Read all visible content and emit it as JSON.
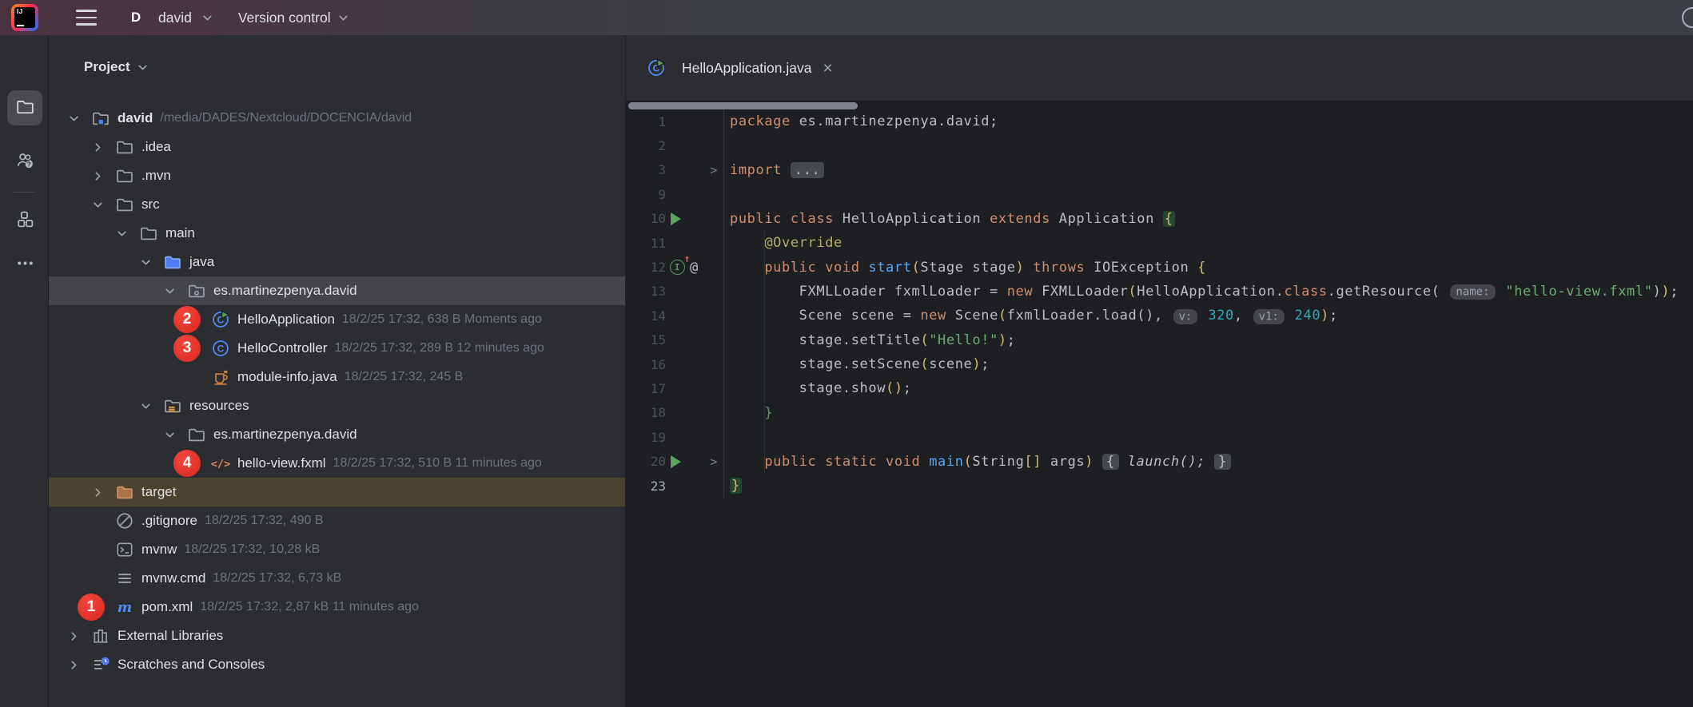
{
  "colors": {
    "topbar_tint": "#4C3340",
    "panel_bg": "#2B2D30",
    "editor_bg": "#1E1F22",
    "selected_row": "#43454A",
    "excluded_row": "#4A432F",
    "badge_red": "#E0382D",
    "keyword": "#CF8E6D",
    "string": "#6AAB73",
    "number": "#2AACB8",
    "method": "#56A8F5",
    "annotation": "#B3AE60",
    "accent_blue": "#4D7DF0"
  },
  "topbar": {
    "avatar_letter": "D",
    "project_name": "david",
    "vcs_label": "Version control"
  },
  "activity_bar": {
    "items": [
      {
        "name": "project",
        "icon": "folder",
        "selected": true
      },
      {
        "name": "learn",
        "icon": "people-help",
        "selected": false
      },
      {
        "name": "structure",
        "icon": "structure",
        "selected": false
      },
      {
        "name": "more",
        "icon": "more",
        "selected": false
      }
    ]
  },
  "project_panel": {
    "title": "Project",
    "rows": [
      {
        "indent": 0,
        "chevron": "down",
        "icon": "folder-root",
        "label": "david",
        "bold": true,
        "meta": "/media/DADES/Nextcloud/DOCENCIA/david"
      },
      {
        "indent": 1,
        "chevron": "right",
        "icon": "folder",
        "label": ".idea"
      },
      {
        "indent": 1,
        "chevron": "right",
        "icon": "folder",
        "label": ".mvn"
      },
      {
        "indent": 1,
        "chevron": "down",
        "icon": "folder",
        "label": "src"
      },
      {
        "indent": 2,
        "chevron": "down",
        "icon": "folder",
        "label": "main"
      },
      {
        "indent": 3,
        "chevron": "down",
        "icon": "folder-java",
        "label": "java"
      },
      {
        "indent": 4,
        "chevron": "down",
        "icon": "package",
        "label": "es.martinezpenya.david",
        "state": "selected"
      },
      {
        "indent": 5,
        "chevron": null,
        "icon": "class-run",
        "label": "HelloApplication",
        "meta": "18/2/25 17:32, 638 B Moments ago",
        "badge": "2"
      },
      {
        "indent": 5,
        "chevron": null,
        "icon": "class",
        "label": "HelloController",
        "meta": "18/2/25 17:32, 289 B 12 minutes ago",
        "badge": "3"
      },
      {
        "indent": 5,
        "chevron": null,
        "icon": "java-cup",
        "label": "module-info.java",
        "meta": "18/2/25 17:32, 245 B"
      },
      {
        "indent": 3,
        "chevron": "down",
        "icon": "folder-res",
        "label": "resources"
      },
      {
        "indent": 4,
        "chevron": "down",
        "icon": "folder",
        "label": "es.martinezpenya.david"
      },
      {
        "indent": 5,
        "chevron": null,
        "icon": "fxml",
        "label": "hello-view.fxml",
        "meta": "18/2/25 17:32, 510 B 11 minutes ago",
        "badge": "4"
      },
      {
        "indent": 1,
        "chevron": "right",
        "icon": "folder-exc",
        "label": "target",
        "state": "excluded"
      },
      {
        "indent": 1,
        "chevron": null,
        "icon": "ignored",
        "label": ".gitignore",
        "meta": "18/2/25 17:32, 490 B"
      },
      {
        "indent": 1,
        "chevron": null,
        "icon": "terminal",
        "label": "mvnw",
        "meta": "18/2/25 17:32, 10,28 kB"
      },
      {
        "indent": 1,
        "chevron": null,
        "icon": "text-lines",
        "label": "mvnw.cmd",
        "meta": "18/2/25 17:32, 6,73 kB"
      },
      {
        "indent": 1,
        "chevron": null,
        "icon": "maven",
        "label": "pom.xml",
        "meta": "18/2/25 17:32, 2,87 kB 11 minutes ago",
        "badge": "1"
      },
      {
        "indent": 0,
        "chevron": "right",
        "icon": "ext-lib",
        "label": "External Libraries"
      },
      {
        "indent": 0,
        "chevron": "right",
        "icon": "scratches",
        "label": "Scratches and Consoles"
      }
    ]
  },
  "editor": {
    "tab": {
      "icon": "class-run",
      "label": "HelloApplication.java",
      "close": "×"
    },
    "lines": [
      {
        "n": "1",
        "seg": [
          [
            "kw",
            "package"
          ],
          [
            "id",
            " es.martinezpenya.david;"
          ]
        ]
      },
      {
        "n": "2",
        "seg": []
      },
      {
        "n": "3",
        "gutter": [
          "fold"
        ],
        "seg": [
          [
            "kw",
            "import"
          ],
          [
            "id",
            " "
          ],
          [
            "fold",
            "..."
          ]
        ]
      },
      {
        "n": "9",
        "seg": []
      },
      {
        "n": "10",
        "gutter": [
          "run"
        ],
        "seg": [
          [
            "kw",
            "public class "
          ],
          [
            "id",
            "HelloApplication "
          ],
          [
            "kw",
            "extends "
          ],
          [
            "id",
            "Application "
          ],
          [
            "brhl",
            "{"
          ]
        ]
      },
      {
        "n": "11",
        "seg": [
          [
            "id",
            "    "
          ],
          [
            "ann",
            "@Override"
          ]
        ]
      },
      {
        "n": "12",
        "gutter": [
          "override",
          "at"
        ],
        "seg": [
          [
            "id",
            "    "
          ],
          [
            "kw",
            "public void "
          ],
          [
            "mth",
            "start"
          ],
          [
            "bry",
            "("
          ],
          [
            "id",
            "Stage stage"
          ],
          [
            "bry",
            ")"
          ],
          [
            "kw",
            " throws "
          ],
          [
            "id",
            "IOException "
          ],
          [
            "bry",
            "{"
          ]
        ]
      },
      {
        "n": "13",
        "seg": [
          [
            "id",
            "        FXMLLoader fxmlLoader = "
          ],
          [
            "kw",
            "new"
          ],
          [
            "id",
            " FXMLLoader"
          ],
          [
            "bry",
            "("
          ],
          [
            "id",
            "HelloApplication."
          ],
          [
            "kw",
            "class"
          ],
          [
            "id",
            ".getResource( "
          ],
          [
            "hint",
            "name:"
          ],
          [
            "id",
            " "
          ],
          [
            "str",
            "\"hello-view.fxml\""
          ],
          [
            "id",
            ")"
          ],
          [
            "bry",
            ")"
          ],
          [
            "id",
            ";"
          ]
        ]
      },
      {
        "n": "14",
        "seg": [
          [
            "id",
            "        Scene scene = "
          ],
          [
            "kw",
            "new"
          ],
          [
            "id",
            " Scene"
          ],
          [
            "bry",
            "("
          ],
          [
            "id",
            "fxmlLoader.load()"
          ],
          [
            "id",
            ", "
          ],
          [
            "hint",
            "v:"
          ],
          [
            "id",
            " "
          ],
          [
            "num",
            "320"
          ],
          [
            "id",
            ", "
          ],
          [
            "hint",
            "v1:"
          ],
          [
            "id",
            " "
          ],
          [
            "num",
            "240"
          ],
          [
            "bry",
            ")"
          ],
          [
            "id",
            ";"
          ]
        ]
      },
      {
        "n": "15",
        "seg": [
          [
            "id",
            "        stage.setTitle"
          ],
          [
            "bry",
            "("
          ],
          [
            "str",
            "\"Hello!\""
          ],
          [
            "bry",
            ")"
          ],
          [
            "id",
            ";"
          ]
        ]
      },
      {
        "n": "16",
        "seg": [
          [
            "id",
            "        stage.setScene"
          ],
          [
            "bry",
            "("
          ],
          [
            "id",
            "scene"
          ],
          [
            "bry",
            ")"
          ],
          [
            "id",
            ";"
          ]
        ]
      },
      {
        "n": "17",
        "seg": [
          [
            "id",
            "        stage.show"
          ],
          [
            "bry",
            "()"
          ],
          [
            "id",
            ";"
          ]
        ]
      },
      {
        "n": "18",
        "seg": [
          [
            "id",
            "    "
          ],
          [
            "brg",
            "}"
          ]
        ]
      },
      {
        "n": "19",
        "seg": []
      },
      {
        "n": "20",
        "gutter": [
          "run",
          "fold"
        ],
        "seg": [
          [
            "id",
            "    "
          ],
          [
            "kw",
            "public static void "
          ],
          [
            "mth",
            "main"
          ],
          [
            "bry",
            "("
          ],
          [
            "id",
            "String"
          ],
          [
            "bry",
            "[]"
          ],
          [
            "id",
            " args"
          ],
          [
            "bry",
            ")"
          ],
          [
            "id",
            " "
          ],
          [
            "fold",
            "{"
          ],
          [
            "ital",
            " launch(); "
          ],
          [
            "fold",
            "}"
          ]
        ]
      },
      {
        "n": "23",
        "active": true,
        "seg": [
          [
            "brhl",
            "}"
          ]
        ]
      }
    ]
  }
}
